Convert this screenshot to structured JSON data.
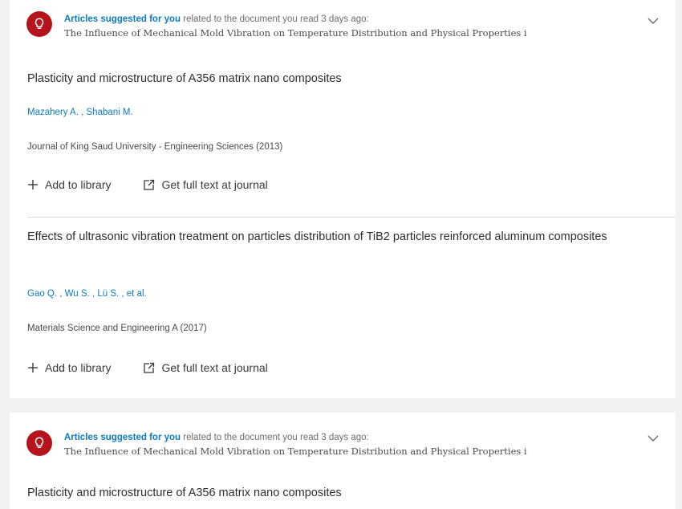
{
  "recommendations": [
    {
      "label_strong": "Articles suggested for you",
      "label_rest": " related to the document you read 3 days ago:",
      "source_document": "The Influence of Mechanical Mold Vibration on Temperature Distribution and Physical Properties i",
      "articles": [
        {
          "title": "Plasticity and microstructure of A356 matrix nano composites",
          "authors": "Mazahery A. , Shabani M.",
          "source": "Journal of King Saud University - Engineering Sciences (2013)",
          "add_label": "Add to library",
          "fulltext_label": "Get full text at journal"
        },
        {
          "title": "Effects of ultrasonic vibration treatment on particles distribution of TiB2 particles reinforced aluminum composites",
          "authors": "Gao Q. , Wu S. , Lü S. , et al.",
          "source": "Materials Science and Engineering A (2017)",
          "add_label": "Add to library",
          "fulltext_label": "Get full text at journal"
        }
      ]
    },
    {
      "label_strong": "Articles suggested for you",
      "label_rest": " related to the document you read 3 days ago:",
      "source_document": "The Influence of Mechanical Mold Vibration on Temperature Distribution and Physical Properties i",
      "articles": [
        {
          "title": "Plasticity and microstructure of A356 matrix nano composites"
        }
      ]
    }
  ],
  "colors": {
    "accent": "#0c7cc0",
    "icon_badge": "#b5141c",
    "background": "#f2f2f2"
  },
  "icons": {
    "recommendation": "lightbulb-icon",
    "expand": "chevron-down-icon",
    "add": "plus-icon",
    "fulltext": "external-link-icon"
  }
}
